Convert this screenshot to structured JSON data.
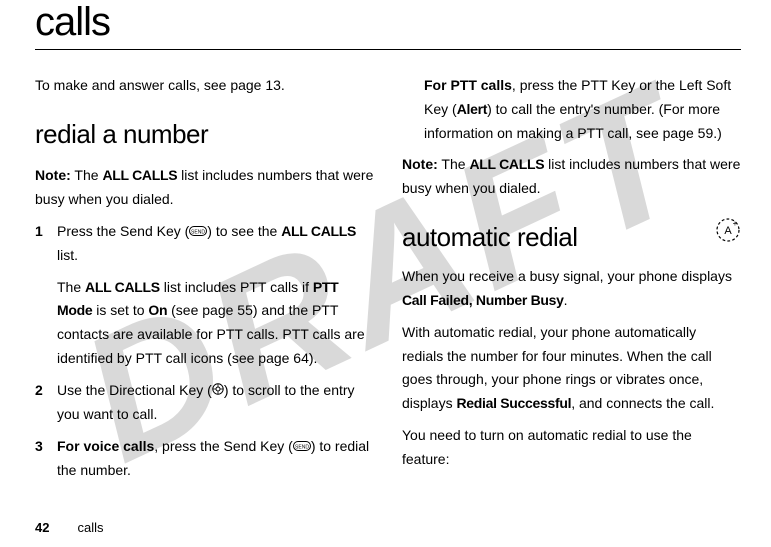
{
  "watermark": "DRAFT",
  "title": "calls",
  "col1": {
    "intro": "To make and answer calls, see page 13.",
    "heading": "redial a number",
    "note_label": "Note:",
    "note_pre": " The ",
    "allcalls": "ALL CALLS",
    "note_post": " list includes numbers that were busy when you dialed.",
    "step1_num": "1",
    "step1_a": "Press the Send Key (",
    "step1_b": ") to see the ",
    "step1_c": " list.",
    "step1_sub_a": "The ",
    "step1_sub_b": " list includes PTT calls if ",
    "pttmode": "PTT Mode",
    "step1_sub_c": " is set to ",
    "on": "On",
    "step1_sub_d": " (see page 55) and the PTT contacts are available for PTT calls. PTT calls are identified by PTT call icons (see page 64).",
    "step2_num": "2",
    "step2_a": "Use the Directional Key (",
    "step2_b": ") to scroll to the entry you want to call.",
    "step3_num": "3",
    "step3_bold": "For voice calls",
    "step3_a": ", press the Send Key (",
    "step3_b": ") to redial the number."
  },
  "col2": {
    "ptt_bold": "For PTT calls",
    "ptt_a": ", press the PTT Key or the Left Soft Key (",
    "alert": "Alert",
    "ptt_b": ") to call the entry's number. (For more information on making a PTT call, see page 59.)",
    "note_label": "Note:",
    "note_pre": " The ",
    "note_post": " list includes numbers that were busy when you dialed.",
    "heading": "automatic redial",
    "auto_a": "When you receive a busy signal, your phone displays ",
    "callfailed": "Call Failed, Number Busy",
    "auto_b": ".",
    "auto2_a": "With automatic redial, your phone automatically redials the number for four minutes. When the call goes through, your phone rings or vibrates once, displays ",
    "redial_success": "Redial Successful",
    "auto2_b": ", and connects the call.",
    "auto3": "You need to turn on automatic redial to use the feature:"
  },
  "footer": {
    "page": "42",
    "section": "calls"
  }
}
